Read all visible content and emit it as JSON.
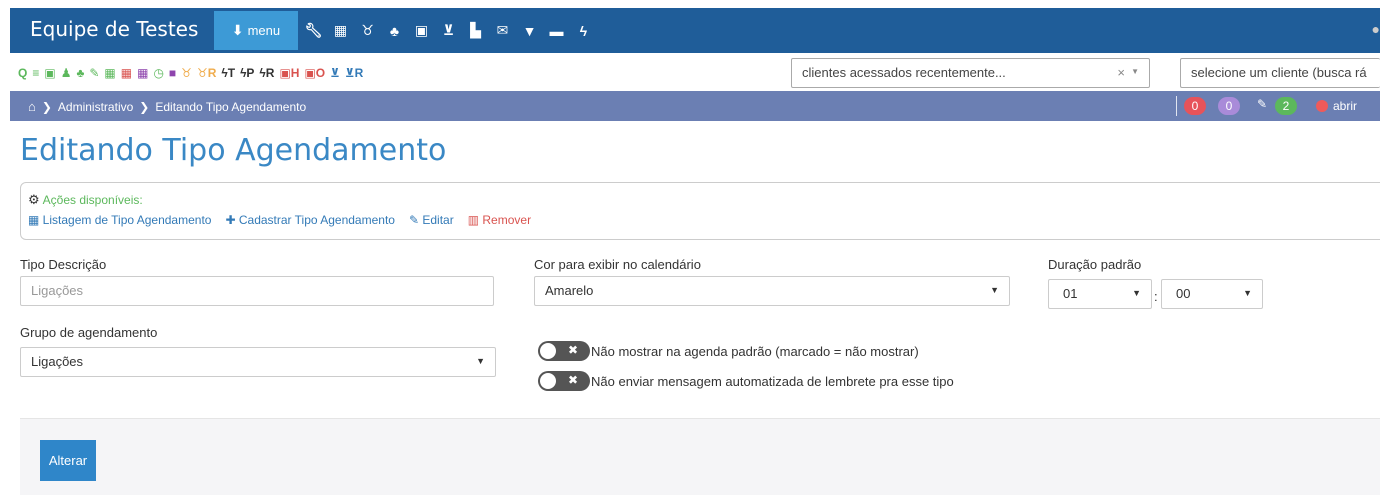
{
  "app": {
    "brand": "Equipe de Testes",
    "menu_label": "menu",
    "nav_icons": [
      "wrench-icon",
      "calendar-icon",
      "stethoscope-icon",
      "users-icon",
      "money-icon",
      "cart-icon",
      "file-icon",
      "envelope-icon",
      "filter-icon",
      "monitor-icon",
      "bolt-icon"
    ]
  },
  "toolbar": {
    "icons": [
      {
        "name": "search-icon",
        "glyph": "Q",
        "color": "#5cb85c"
      },
      {
        "name": "list-icon",
        "glyph": "≡",
        "color": "#5cb85c"
      },
      {
        "name": "money-icon",
        "glyph": "▣",
        "color": "#5cb85c"
      },
      {
        "name": "user-icon",
        "glyph": "♟",
        "color": "#5cb85c"
      },
      {
        "name": "users-icon",
        "glyph": "♣",
        "color": "#5cb85c"
      },
      {
        "name": "pencil-icon",
        "glyph": "✎",
        "color": "#5cb85c"
      },
      {
        "name": "calendar-icon",
        "glyph": "▦",
        "color": "#5cb85c"
      },
      {
        "name": "calendar-red-icon",
        "glyph": "▦",
        "color": "#d9534f"
      },
      {
        "name": "calendar-purple-icon",
        "glyph": "▦",
        "color": "#8e44ad"
      },
      {
        "name": "clock-icon",
        "glyph": "◷",
        "color": "#5cb85c"
      },
      {
        "name": "bookmark-icon",
        "glyph": "■",
        "color": "#8e44ad"
      },
      {
        "name": "stethoscope-icon",
        "glyph": "♉",
        "color": "#f0ad4e"
      },
      {
        "name": "stethoscope-r-icon",
        "glyph": "♉R",
        "color": "#f0ad4e"
      },
      {
        "name": "bolt-t-icon",
        "glyph": "ϟT",
        "color": "#333333"
      },
      {
        "name": "bolt-p-icon",
        "glyph": "ϟP",
        "color": "#333333"
      },
      {
        "name": "bolt-r-icon",
        "glyph": "ϟR",
        "color": "#333333"
      },
      {
        "name": "money-h-icon",
        "glyph": "▣H",
        "color": "#d9534f"
      },
      {
        "name": "money-o-icon",
        "glyph": "▣O",
        "color": "#d9534f"
      },
      {
        "name": "cart-icon",
        "glyph": "⊻",
        "color": "#337ab7"
      },
      {
        "name": "cart-r-icon",
        "glyph": "⊻R",
        "color": "#337ab7"
      }
    ],
    "recent_clients": "clientes acessados recentemente...",
    "client_search": "selecione um cliente (busca rá"
  },
  "breadcrumb": {
    "items": [
      "Administrativo",
      "Editando Tipo Agendamento"
    ],
    "badges": [
      {
        "value": "0",
        "color": "#e7535a"
      },
      {
        "value": "0",
        "color": "#a98bd9"
      },
      {
        "value": "2",
        "color": "#5cb85c"
      }
    ],
    "open_label": "abrir"
  },
  "page": {
    "title": "Editando Tipo Agendamento"
  },
  "actions": {
    "title": "Ações disponíveis:",
    "links": {
      "list": "Listagem de Tipo Agendamento",
      "create": "Cadastrar Tipo Agendamento",
      "edit": "Editar",
      "remove": "Remover"
    }
  },
  "form": {
    "tipo_descricao": {
      "label": "Tipo Descrição",
      "value": "Ligações"
    },
    "cor": {
      "label": "Cor para exibir no calendário",
      "value": "Amarelo"
    },
    "duracao": {
      "label": "Duração padrão",
      "hours": "01",
      "minutes": "00",
      "separator": ":"
    },
    "grupo": {
      "label": "Grupo de agendamento",
      "value": "Ligações"
    },
    "toggle_agenda": {
      "label": "Não mostrar na agenda padrão (marcado = não mostrar)",
      "checked": false
    },
    "toggle_mensagem": {
      "label": "Não enviar mensagem automatizada de lembrete pra esse tipo",
      "checked": false
    },
    "submit": "Alterar"
  }
}
